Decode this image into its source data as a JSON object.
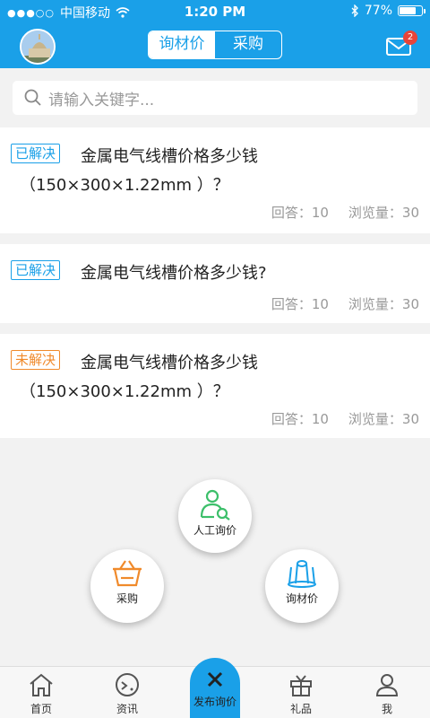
{
  "status_bar": {
    "carrier": "中国移动",
    "time": "1:20 PM",
    "battery": "77%",
    "battery_level": 0.77
  },
  "header": {
    "tabs": [
      {
        "label": "询材价",
        "active": true
      },
      {
        "label": "采购",
        "active": false
      }
    ],
    "mail_badge": "2"
  },
  "search": {
    "placeholder": "请输入关键字..."
  },
  "questions": [
    {
      "status": "已解决",
      "title_line1": "金属电气线槽价格多少钱",
      "title_line2": "（150×300×1.22mm ）？",
      "answers": "回答：10",
      "views": "浏览量：30"
    },
    {
      "status": "已解决",
      "title_line1": "金属电气线槽价格多少钱?",
      "title_line2": "",
      "answers": "回答：10",
      "views": "浏览量：30"
    },
    {
      "status": "未解决",
      "title_line1": "金属电气线槽价格多少钱",
      "title_line2": "（150×300×1.22mm ）？",
      "answers": "回答：10",
      "views": "浏览量：30"
    }
  ],
  "float_menu": {
    "manual": "人工询价",
    "purchase": "采购",
    "inquiry": "询材价"
  },
  "tabbar": {
    "home": "首页",
    "news": "资讯",
    "publish": "发布询价",
    "gifts": "礼品",
    "me": "我"
  },
  "colors": {
    "brand_blue": "#1aa0e8",
    "solved": "#1aa0e8",
    "unsolved": "#f08a2b",
    "manual_icon": "#3cbf6a",
    "purchase_icon": "#f08a2b",
    "inquiry_icon": "#1aa0e8"
  },
  "icons": {
    "signal": "signal-dots-icon",
    "wifi": "wifi-icon",
    "bluetooth": "bluetooth-icon",
    "battery": "battery-icon",
    "mail": "mail-icon",
    "search": "search-icon",
    "manual": "person-search-icon",
    "purchase": "basket-icon",
    "inquiry": "pipes-icon",
    "home": "home-icon",
    "news": "news-icon",
    "publish": "close-icon",
    "gifts": "gift-icon",
    "me": "user-icon"
  }
}
